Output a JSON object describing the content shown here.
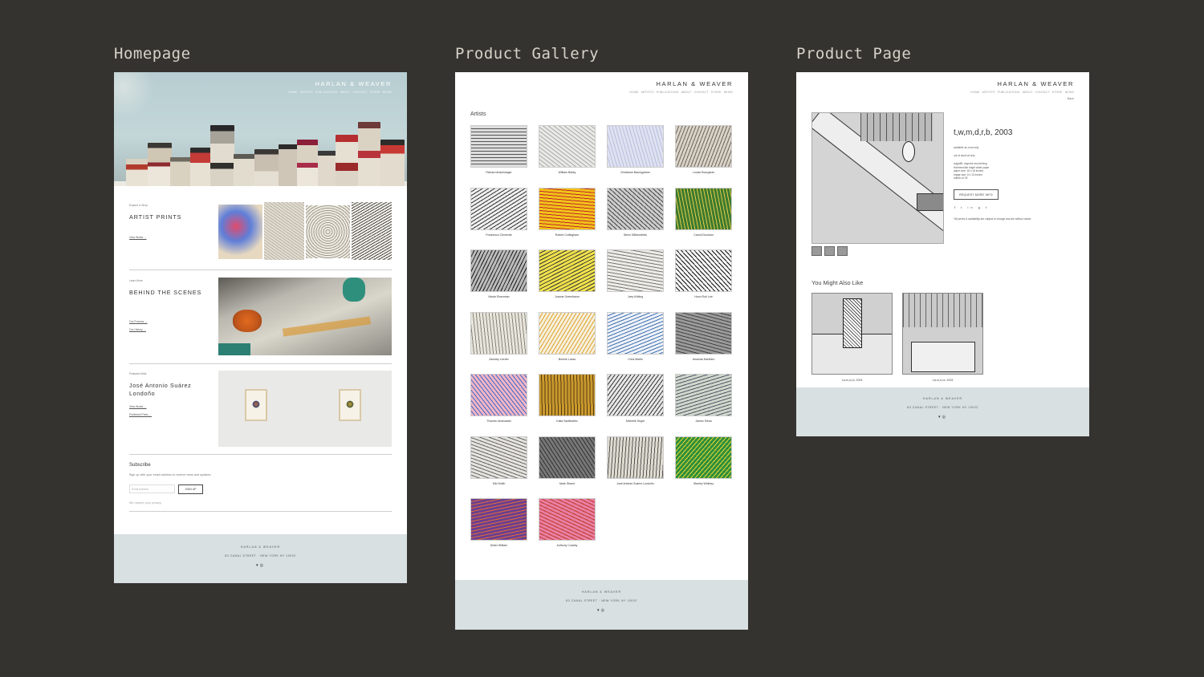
{
  "columns": {
    "homepage": "Homepage",
    "gallery": "Product Gallery",
    "product": "Product Page"
  },
  "site": {
    "brand": "HARLAN & WEAVER",
    "nav": [
      "HOME",
      "ARTISTS",
      "PUBLICATIONS",
      "ABOUT",
      "CONTACT",
      "STORE",
      "NEWS"
    ],
    "footer_brand": "HARLAN & WEAVER",
    "footer_address": "83 CANAL STREET · NEW YORK NY 10002",
    "footer_social": [
      "twitter-icon",
      "instagram-icon"
    ]
  },
  "homepage": {
    "sections": [
      {
        "kicker": "Explore & Shop",
        "title": "ARTIST PRINTS",
        "links": [
          "View Works →"
        ]
      },
      {
        "kicker": "Learn More",
        "title": "BEHIND THE SCENES",
        "links": [
          "Our Process →",
          "Our History →"
        ]
      },
      {
        "kicker": "Featured Artist",
        "title": "José Antonio Suárez Londoño",
        "links": [
          "View Works →",
          "Published Prints →"
        ]
      }
    ],
    "subscribe": {
      "title": "Subscribe",
      "text": "Sign up with your email address to receive news and updates.",
      "placeholder": "Email Address",
      "button": "SIGN UP",
      "note": "We respect your privacy."
    }
  },
  "gallery": {
    "label": "Artists",
    "artists": [
      "Richard Artschwager",
      "William Bailey",
      "Christiane Baumgartner",
      "Louise Bourgeois",
      "Francesco Clemente",
      "Robert Cottingham",
      "Steve DiBenedetto",
      "Carroll Dunham",
      "Nicole Eisenman",
      "Joanne Greenbaum",
      "Joey Kötting",
      "Hoon Ruh Lee",
      "Zachary Leener",
      "Bonnie Lucas",
      "Chris Martin",
      "Amanda Martinez",
      "Thomas Nozkowski",
      "Katia Santibañez",
      "Michelle Segre",
      "James Siena",
      "Kiki Smith",
      "Mark Strand",
      "José Antonio Suárez Londoño",
      "Stanley Whitney",
      "Didier William",
      "Anthony Cudahy"
    ]
  },
  "product": {
    "back": "Back",
    "title": "t,w,m,d,r,b, 2003",
    "availability": "available as a set only",
    "stock": "out of stock at only",
    "details": [
      "sugarlift, drypoint and etching",
      "Hahnemühle bright white paper",
      "paper size: 16 x 18 inches",
      "image size: 8 x 10 inches",
      "edition of 25"
    ],
    "button": "REQUEST MORE INFO",
    "social": "f  t  in  g  t",
    "disclaimer": "*All prices & availability are subject to change and are without notice.",
    "also_like": "You Might Also Like",
    "related": [
      "t,w,m,d,r,b, 2003",
      "t,w,m,d,r,b, 2003"
    ]
  },
  "colors": {
    "background": "#353330",
    "footer": "#d9e0e2",
    "title": "#d6d2c8"
  }
}
